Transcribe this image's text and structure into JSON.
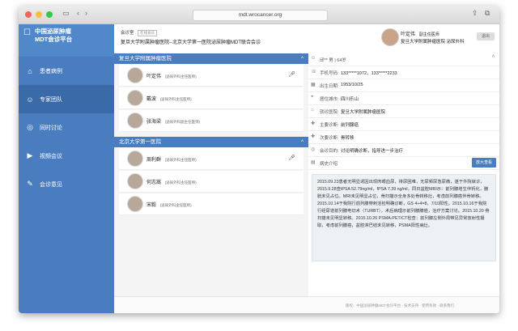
{
  "browser": {
    "url": "mdt.wrocancer.org",
    "colors": {
      "close": "#fc605c",
      "minimize": "#fdbc40",
      "maximize": "#34c84a"
    }
  },
  "sidebar": {
    "brand_line1": "中国泌尿肿瘤",
    "brand_line2": "MDT会诊平台",
    "items": [
      {
        "label": "患者病例",
        "icon": "patient-record-icon"
      },
      {
        "label": "专家团队",
        "icon": "expert-team-icon"
      },
      {
        "label": "同时讨论",
        "icon": "discussion-icon"
      },
      {
        "label": "视频会议",
        "icon": "video-icon"
      },
      {
        "label": "会诊意见",
        "icon": "opinion-icon"
      }
    ],
    "active_index": 1
  },
  "header": {
    "room_label": "会诊室",
    "room_tag": "在线会诊",
    "meeting_title": "复旦大学附属肿瘤医院--北京大学第一医院泌尿肿瘤MDT联合会诊",
    "doctor_name": "叶定伟",
    "doctor_title": "副主任医师",
    "doctor_hospital": "复旦大学附属肿瘤医院 泌尿外科",
    "logout_label": "退出"
  },
  "team": {
    "groups": [
      {
        "name": "复旦大学附属肿瘤医院",
        "members": [
          {
            "name": "叶定伟",
            "title": "(泌尿外科主任医师)",
            "mic": true
          },
          {
            "name": "戴波",
            "title": "(泌尿外科主任医师)",
            "mic": false
          },
          {
            "name": "张海梁",
            "title": "(泌尿外科副主任医师)",
            "mic": false
          }
        ]
      },
      {
        "name": "北京大学第一医院",
        "members": [
          {
            "name": "周利群",
            "title": "(泌尿外科主任医师)",
            "mic": true
          },
          {
            "name": "何志嵩",
            "title": "(泌尿外科主任医师)",
            "mic": false
          },
          {
            "name": "宋毅",
            "title": "(泌尿外科主任医师)",
            "mic": false
          }
        ]
      }
    ]
  },
  "detail": {
    "patient": "邱**  男 | 64岁",
    "rows": [
      {
        "icon": "phone-icon",
        "label": "手机号码:",
        "value": "133*****1072，133*****2233"
      },
      {
        "icon": "calendar-icon",
        "label": "出生日期:",
        "value": "1953/10/25"
      },
      {
        "icon": "location-icon",
        "label": "居住城市:",
        "value": "四川乐山"
      },
      {
        "icon": "hospital-icon",
        "label": "就诊医院:",
        "value": "复旦大学附属肿瘤医院"
      },
      {
        "icon": "diagnosis-icon",
        "label": "主要诊断:",
        "value": "前列腺癌"
      },
      {
        "icon": "secondary-icon",
        "label": "次要诊断:",
        "value": "骨转移"
      },
      {
        "icon": "target-icon",
        "label": "会诊目的:",
        "value": "讨论明确诊断，指导进一步治疗"
      }
    ],
    "history_label": "病史介绍",
    "view_button": "放大查看",
    "history_text": "2015.09.23患者无明显诱因出现肉眼血尿，排尿困难，无尿频尿急尿痛，遂于外院就诊，2015.9.28查tPSA 52.79ng/ml，fPSA 7.39 ng/ml，同日盆腔MRI示：前列腺增生伴钙化，膀胱未见占位。MRI未见明显占位，骨扫描示全身多处骨转移灶，考虑前列腺癌伴骨转移。2015.10.14于我院行前列腺穿刺活检明确诊断，GS 4+4=8，7/10阳性。2015.10.16于我院行经尿道前列腺电切术（TURBT），术后病理示前列腺腺癌，治疗方案讨论。2015.10.20 骨扫描未见明显转移。2015.10.26 PSMA-PET/CT检查：前列腺左侧外周带见异常放射性摄取，考虑前列腺癌，盆腔淋巴结未见转移，PSMA阳性病灶。"
  },
  "footer": {
    "text": "版权：中国泌尿肿瘤MDT会诊平台 · 技术支持 · 使用条款 · 联系我们"
  }
}
